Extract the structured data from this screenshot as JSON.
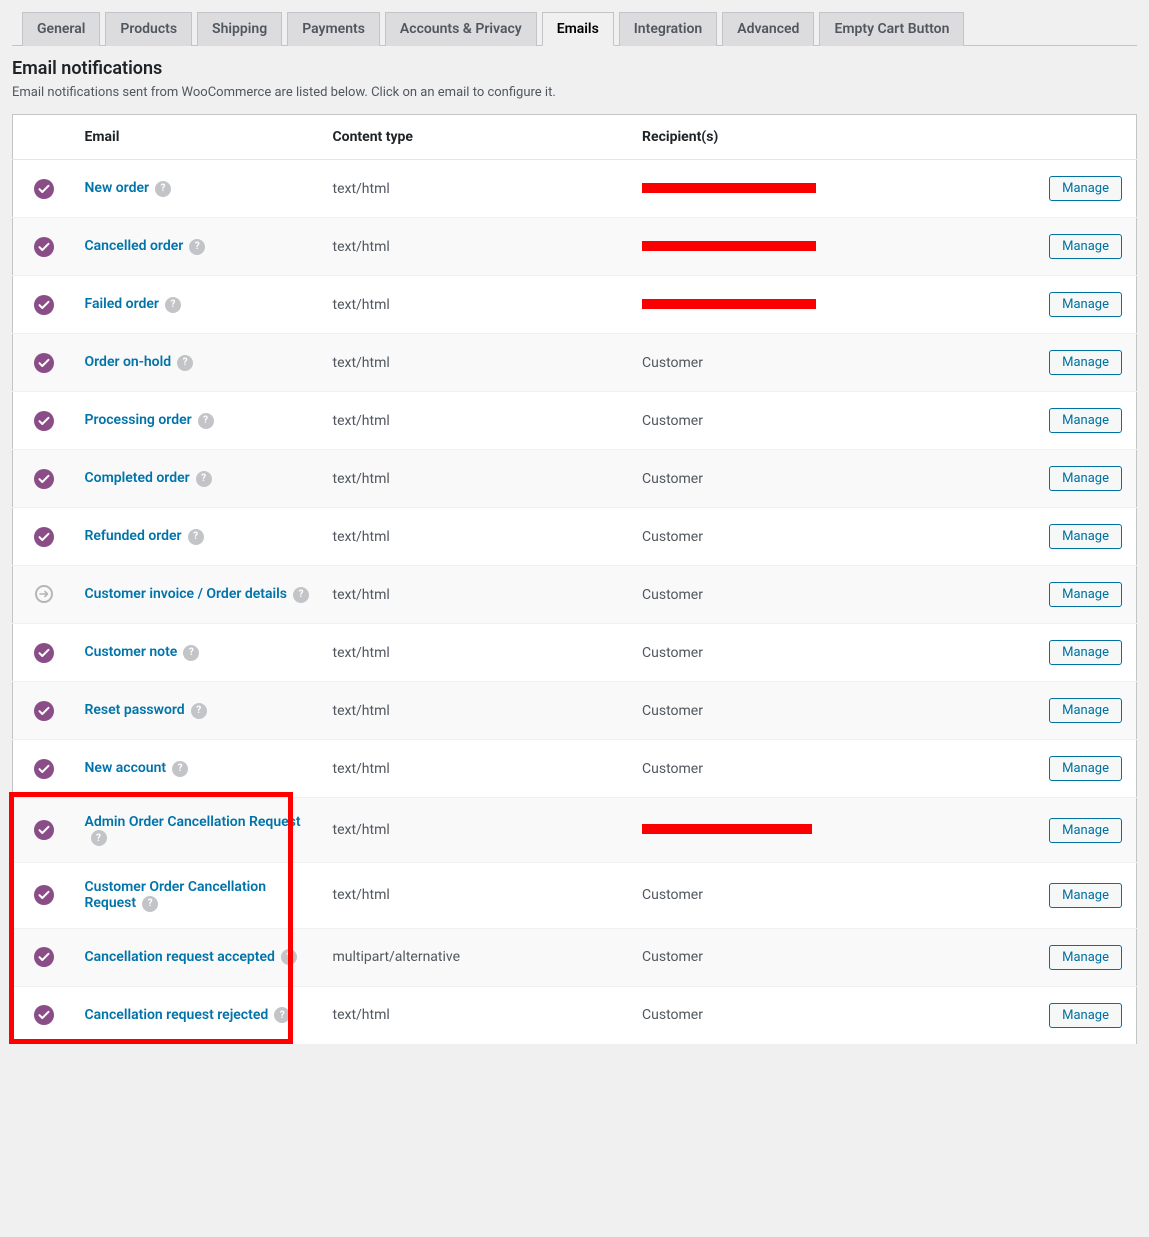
{
  "tabs": [
    {
      "label": "General",
      "active": false
    },
    {
      "label": "Products",
      "active": false
    },
    {
      "label": "Shipping",
      "active": false
    },
    {
      "label": "Payments",
      "active": false
    },
    {
      "label": "Accounts & Privacy",
      "active": false
    },
    {
      "label": "Emails",
      "active": true
    },
    {
      "label": "Integration",
      "active": false
    },
    {
      "label": "Advanced",
      "active": false
    },
    {
      "label": "Empty Cart Button",
      "active": false
    }
  ],
  "section": {
    "title": "Email notifications",
    "desc": "Email notifications sent from WooCommerce are listed below. Click on an email to configure it."
  },
  "columns": {
    "status": "",
    "email": "Email",
    "content_type": "Content type",
    "recipients": "Recipient(s)",
    "action": ""
  },
  "manage_label": "Manage",
  "emails": [
    {
      "status": "enabled",
      "name": "New order",
      "content_type": "text/html",
      "recipient_type": "redacted",
      "redact_w": 174
    },
    {
      "status": "enabled",
      "name": "Cancelled order",
      "content_type": "text/html",
      "recipient_type": "redacted",
      "redact_w": 174
    },
    {
      "status": "enabled",
      "name": "Failed order",
      "content_type": "text/html",
      "recipient_type": "redacted",
      "redact_w": 174
    },
    {
      "status": "enabled",
      "name": "Order on-hold",
      "content_type": "text/html",
      "recipient": "Customer"
    },
    {
      "status": "enabled",
      "name": "Processing order",
      "content_type": "text/html",
      "recipient": "Customer"
    },
    {
      "status": "enabled",
      "name": "Completed order",
      "content_type": "text/html",
      "recipient": "Customer"
    },
    {
      "status": "enabled",
      "name": "Refunded order",
      "content_type": "text/html",
      "recipient": "Customer"
    },
    {
      "status": "manual",
      "name": "Customer invoice / Order details",
      "content_type": "text/html",
      "recipient": "Customer"
    },
    {
      "status": "enabled",
      "name": "Customer note",
      "content_type": "text/html",
      "recipient": "Customer"
    },
    {
      "status": "enabled",
      "name": "Reset password",
      "content_type": "text/html",
      "recipient": "Customer"
    },
    {
      "status": "enabled",
      "name": "New account",
      "content_type": "text/html",
      "recipient": "Customer"
    },
    {
      "status": "enabled",
      "name": "Admin Order Cancellation Request",
      "content_type": "text/html",
      "recipient_type": "redacted",
      "redact_w": 170,
      "highlight": true
    },
    {
      "status": "enabled",
      "name": "Customer Order Cancellation Request",
      "content_type": "text/html",
      "recipient": "Customer",
      "highlight": true
    },
    {
      "status": "enabled",
      "name": "Cancellation request accepted",
      "content_type": "multipart/alternative",
      "recipient": "Customer",
      "highlight": true
    },
    {
      "status": "enabled",
      "name": "Cancellation request rejected",
      "content_type": "text/html",
      "recipient": "Customer",
      "highlight": true
    }
  ]
}
